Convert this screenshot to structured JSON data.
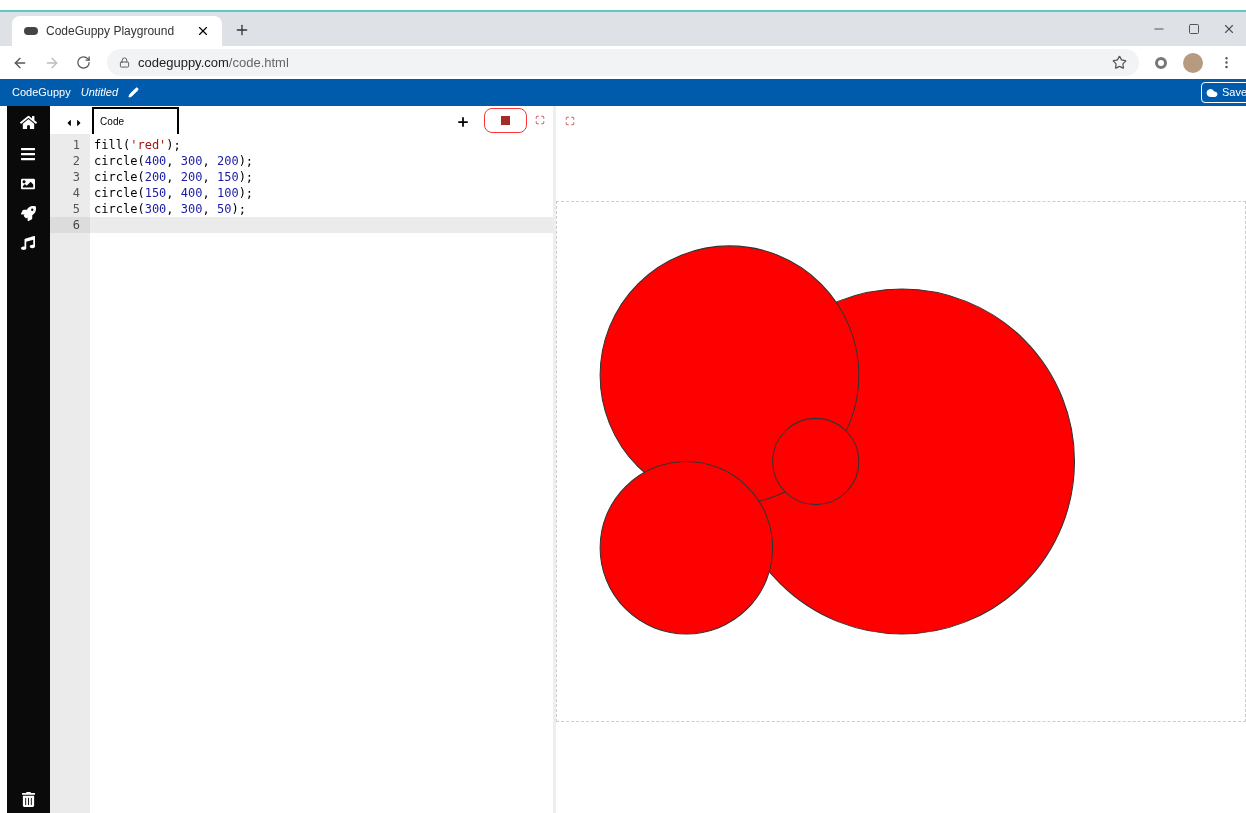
{
  "browser": {
    "tab_title": "CodeGuppy Playground",
    "url_host": "codeguppy.com",
    "url_path": "/code.html"
  },
  "app_bar": {
    "brand": "CodeGuppy",
    "project": "Untitled",
    "save": "Save"
  },
  "editor": {
    "tabs": [
      {
        "label": "Code",
        "selected": true
      }
    ],
    "lines": [
      {
        "number": "1",
        "active": false,
        "tokens": [
          {
            "text": "fill(",
            "kind": "plain"
          },
          {
            "text": "'red'",
            "kind": "string"
          },
          {
            "text": ");",
            "kind": "plain"
          }
        ]
      },
      {
        "number": "2",
        "active": false,
        "tokens": [
          {
            "text": "circle(",
            "kind": "plain"
          },
          {
            "text": "400",
            "kind": "number"
          },
          {
            "text": ", ",
            "kind": "plain"
          },
          {
            "text": "300",
            "kind": "number"
          },
          {
            "text": ", ",
            "kind": "plain"
          },
          {
            "text": "200",
            "kind": "number"
          },
          {
            "text": ");",
            "kind": "plain"
          }
        ]
      },
      {
        "number": "3",
        "active": false,
        "tokens": [
          {
            "text": "circle(",
            "kind": "plain"
          },
          {
            "text": "200",
            "kind": "number"
          },
          {
            "text": ", ",
            "kind": "plain"
          },
          {
            "text": "200",
            "kind": "number"
          },
          {
            "text": ", ",
            "kind": "plain"
          },
          {
            "text": "150",
            "kind": "number"
          },
          {
            "text": ");",
            "kind": "plain"
          }
        ]
      },
      {
        "number": "4",
        "active": false,
        "tokens": [
          {
            "text": "circle(",
            "kind": "plain"
          },
          {
            "text": "150",
            "kind": "number"
          },
          {
            "text": ", ",
            "kind": "plain"
          },
          {
            "text": "400",
            "kind": "number"
          },
          {
            "text": ", ",
            "kind": "plain"
          },
          {
            "text": "100",
            "kind": "number"
          },
          {
            "text": ");",
            "kind": "plain"
          }
        ]
      },
      {
        "number": "5",
        "active": false,
        "tokens": [
          {
            "text": "circle(",
            "kind": "plain"
          },
          {
            "text": "300",
            "kind": "number"
          },
          {
            "text": ", ",
            "kind": "plain"
          },
          {
            "text": "300",
            "kind": "number"
          },
          {
            "text": ", ",
            "kind": "plain"
          },
          {
            "text": "50",
            "kind": "number"
          },
          {
            "text": ");",
            "kind": "plain"
          }
        ]
      },
      {
        "number": "6",
        "active": true
      }
    ]
  }
}
